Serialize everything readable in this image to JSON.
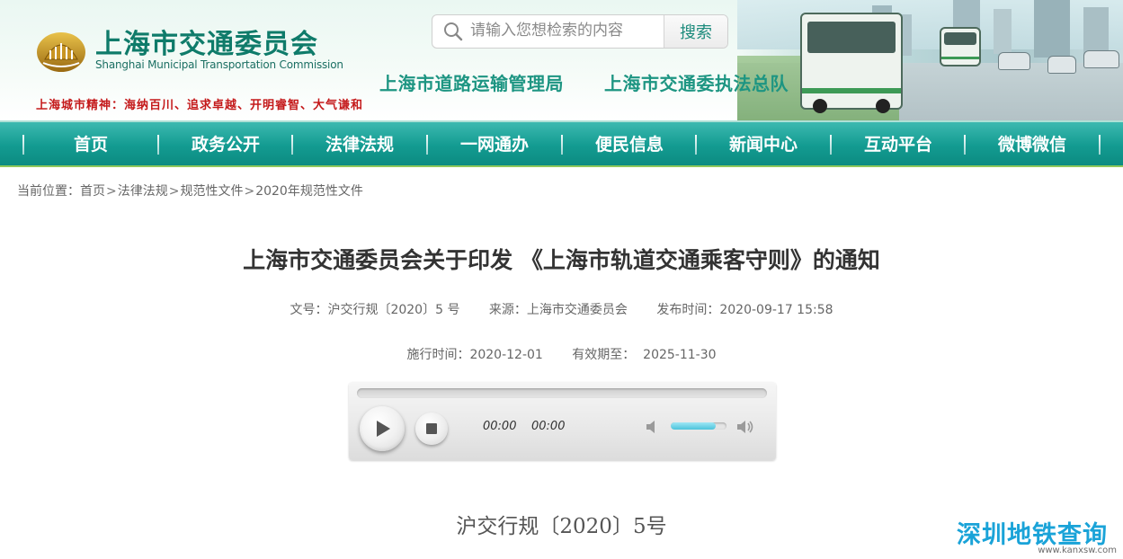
{
  "header": {
    "logo_title": "上海市交通委员会",
    "logo_subtitle": "Shanghai Municipal Transportation Commission",
    "city_spirit": "上海城市精神：海纳百川、追求卓越、开明睿智、大气谦和",
    "search": {
      "placeholder": "请输入您想检索的内容",
      "button_label": "搜索"
    },
    "sub_links": [
      {
        "label": "上海市道路运输管理局"
      },
      {
        "label": "上海市交通委执法总队"
      }
    ]
  },
  "nav": {
    "items": [
      {
        "label": "首页"
      },
      {
        "label": "政务公开"
      },
      {
        "label": "法律法规"
      },
      {
        "label": "一网通办"
      },
      {
        "label": "便民信息"
      },
      {
        "label": "新闻中心"
      },
      {
        "label": "互动平台"
      },
      {
        "label": "微博微信"
      }
    ]
  },
  "breadcrumb": {
    "prefix": "当前位置：",
    "items": [
      "首页",
      "法律法规",
      "规范性文件",
      "2020年规范性文件"
    ]
  },
  "article": {
    "title": "上海市交通委员会关于印发 《上海市轨道交通乘客守则》的通知",
    "doc_no": "文号：沪交行规〔2020〕5 号",
    "source": "来源：上海市交通委员会",
    "publish_time": "发布时间：2020-09-17 15:58",
    "effective_date": "施行时间：2020-12-01",
    "valid_until": "有效期至：  2025-11-30",
    "doc_number_heading": "沪交行规〔2020〕5号"
  },
  "player": {
    "current_time": "00:00",
    "duration": "00:00",
    "progress": 0,
    "volume": 0.8
  },
  "watermark": {
    "text": "深圳地铁查询",
    "url": "www.kanxsw.com"
  },
  "colors": {
    "brand_green": "#0f7b6a",
    "nav_teal": "#139b91",
    "spirit_red": "#c4191a",
    "link_teal": "#1d9582"
  }
}
